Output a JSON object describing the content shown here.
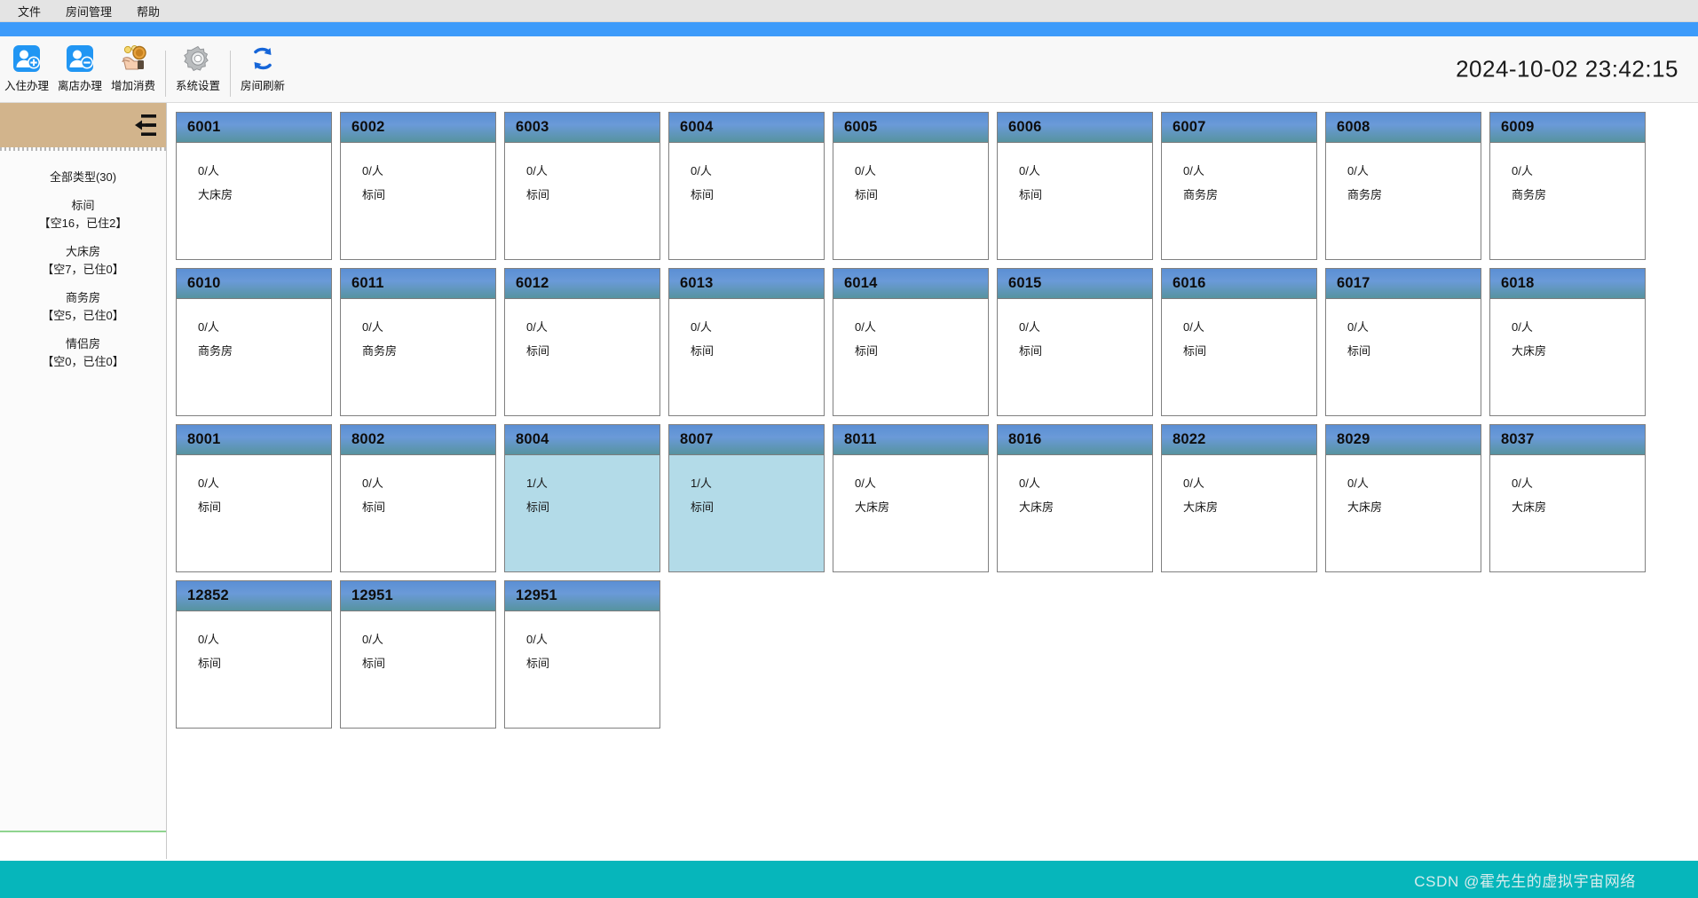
{
  "menubar": {
    "items": [
      {
        "label": "文件",
        "name": "menu-file"
      },
      {
        "label": "房间管理",
        "name": "menu-room-management"
      },
      {
        "label": "帮助",
        "name": "menu-help"
      }
    ]
  },
  "colors": {
    "accent_stripe": "#3d9bfa",
    "sidebar_header": "#d2b48c",
    "card_header_from": "#5b8fd4",
    "card_header_to": "#57939f",
    "occupied_body": "#b3dbe8",
    "bottom_bar": "#06b6bb"
  },
  "toolbar": {
    "buttons": [
      {
        "label": "入住办理",
        "icon": "user-add-icon",
        "name": "check-in-button"
      },
      {
        "label": "离店办理",
        "icon": "user-remove-icon",
        "name": "check-out-button"
      },
      {
        "label": "增加消费",
        "icon": "coin-hand-icon",
        "name": "add-consumption-button"
      },
      {
        "label": "系统设置",
        "icon": "gear-icon",
        "name": "system-settings-button"
      },
      {
        "label": "房间刷新",
        "icon": "refresh-icon",
        "name": "refresh-rooms-button"
      }
    ],
    "clock": "2024-10-02 23:42:15"
  },
  "sidebar": {
    "collapse_icon": "collapse-left-icon",
    "types": [
      {
        "name": "全部类型(30)",
        "stat": ""
      },
      {
        "name": "标间",
        "stat": "【空16，已住2】"
      },
      {
        "name": "大床房",
        "stat": "【空7，已住0】"
      },
      {
        "name": "商务房",
        "stat": "【空5，已住0】"
      },
      {
        "name": "情侣房",
        "stat": "【空0，已住0】"
      }
    ]
  },
  "rooms": [
    {
      "no": "6001",
      "occupancy": "0/人",
      "type": "大床房",
      "occupied": false
    },
    {
      "no": "6002",
      "occupancy": "0/人",
      "type": "标间",
      "occupied": false
    },
    {
      "no": "6003",
      "occupancy": "0/人",
      "type": "标间",
      "occupied": false
    },
    {
      "no": "6004",
      "occupancy": "0/人",
      "type": "标间",
      "occupied": false
    },
    {
      "no": "6005",
      "occupancy": "0/人",
      "type": "标间",
      "occupied": false
    },
    {
      "no": "6006",
      "occupancy": "0/人",
      "type": "标间",
      "occupied": false
    },
    {
      "no": "6007",
      "occupancy": "0/人",
      "type": "商务房",
      "occupied": false
    },
    {
      "no": "6008",
      "occupancy": "0/人",
      "type": "商务房",
      "occupied": false
    },
    {
      "no": "6009",
      "occupancy": "0/人",
      "type": "商务房",
      "occupied": false
    },
    {
      "no": "6010",
      "occupancy": "0/人",
      "type": "商务房",
      "occupied": false
    },
    {
      "no": "6011",
      "occupancy": "0/人",
      "type": "商务房",
      "occupied": false
    },
    {
      "no": "6012",
      "occupancy": "0/人",
      "type": "标间",
      "occupied": false
    },
    {
      "no": "6013",
      "occupancy": "0/人",
      "type": "标间",
      "occupied": false
    },
    {
      "no": "6014",
      "occupancy": "0/人",
      "type": "标间",
      "occupied": false
    },
    {
      "no": "6015",
      "occupancy": "0/人",
      "type": "标间",
      "occupied": false
    },
    {
      "no": "6016",
      "occupancy": "0/人",
      "type": "标间",
      "occupied": false
    },
    {
      "no": "6017",
      "occupancy": "0/人",
      "type": "标间",
      "occupied": false
    },
    {
      "no": "6018",
      "occupancy": "0/人",
      "type": "大床房",
      "occupied": false
    },
    {
      "no": "8001",
      "occupancy": "0/人",
      "type": "标间",
      "occupied": false
    },
    {
      "no": "8002",
      "occupancy": "0/人",
      "type": "标间",
      "occupied": false
    },
    {
      "no": "8004",
      "occupancy": "1/人",
      "type": "标间",
      "occupied": true
    },
    {
      "no": "8007",
      "occupancy": "1/人",
      "type": "标间",
      "occupied": true
    },
    {
      "no": "8011",
      "occupancy": "0/人",
      "type": "大床房",
      "occupied": false
    },
    {
      "no": "8016",
      "occupancy": "0/人",
      "type": "大床房",
      "occupied": false
    },
    {
      "no": "8022",
      "occupancy": "0/人",
      "type": "大床房",
      "occupied": false
    },
    {
      "no": "8029",
      "occupancy": "0/人",
      "type": "大床房",
      "occupied": false
    },
    {
      "no": "8037",
      "occupancy": "0/人",
      "type": "大床房",
      "occupied": false
    },
    {
      "no": "12852",
      "occupancy": "0/人",
      "type": "标间",
      "occupied": false
    },
    {
      "no": "12951",
      "occupancy": "0/人",
      "type": "标间",
      "occupied": false
    },
    {
      "no": "12951",
      "occupancy": "0/人",
      "type": "标间",
      "occupied": false
    }
  ],
  "bottom": {
    "watermark": "CSDN @霍先生的虚拟宇宙网络"
  }
}
